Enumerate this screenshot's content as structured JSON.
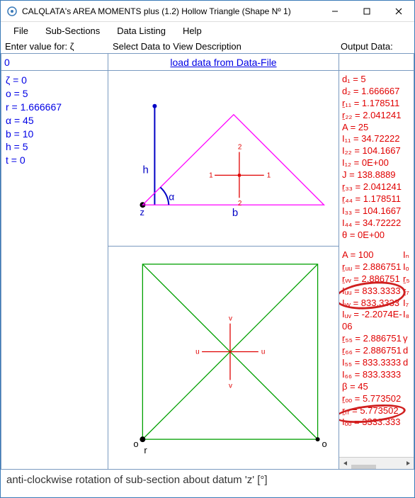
{
  "window": {
    "title": "CALQLATA's   AREA MOMENTS plus (1.2)   Hollow Triangle (Shape Nº 1)"
  },
  "menus": {
    "file": "File",
    "subs": "Sub-Sections",
    "data": "Data Listing",
    "help": "Help"
  },
  "labels": {
    "enter": "Enter value for: ζ",
    "select": "Select Data to View Description",
    "output": "Output Data:"
  },
  "input": {
    "value": "0"
  },
  "link": {
    "text": "load data from Data-File"
  },
  "left": {
    "l1": "ζ = 0",
    "l2": "o = 5",
    "l3": "r = 1.666667",
    "l4": "α = 45",
    "l5": "b = 10",
    "l6": "h = 5",
    "l7": "t = 0"
  },
  "out1": {
    "o1": "d₁ = 5",
    "o2": "d₂ = 1.666667",
    "o3": "ṟ₁₁ = 1.178511",
    "o4": "ṟ₂₂ = 2.041241",
    "o5": "A = 25",
    "o6": "I₁₁ = 34.72222",
    "o7": "I₂₂ = 104.1667",
    "o8": "I₁₂ = 0E+00",
    "o9": "J = 138.8889",
    "o10": "ṟ₃₃ = 2.041241",
    "o11": "ṟ₄₄ = 1.178511",
    "o12": "I₃₃ = 104.1667",
    "o13": "I₄₄ = 34.72222",
    "o14": "θ = 0E+00"
  },
  "out2": {
    "p1": "A = 100",
    "p2": "ṟᵤᵤ = 2.886751",
    "p3": "ṟᵥᵥ = 2.886751",
    "p4": "Iᵤᵤ = 833.3333",
    "p5": "Iᵥᵥ = 833.3333",
    "p6": "Iᵤᵥ = -2.2074E-06",
    "p7": "ṟ₅₅ = 2.886751",
    "p8": "ṟ₆₆ = 2.886751",
    "p9": "I₅₅ = 833.3333",
    "p10": "I₆₆ = 833.3333",
    "p11": "β = 45",
    "p12": "ṟₒₒ = 5.773502",
    "p13": "ṟᵣᵣ = 5.773502",
    "p14": "Iₒₒ = 3333.333",
    "q1": "Iₙ",
    "q2": "Iₒ",
    "q3": "ṟ₅",
    "q4": "ṟ₇",
    "q5": "I₇",
    "q6": "I₈",
    "q7": "γ",
    "q8": "d",
    "q9": "d"
  },
  "status": {
    "text": "anti-clockwise rotation of sub-section about datum 'z' [°]"
  },
  "diag": {
    "h": "h",
    "a": "α",
    "b": "b",
    "z": "z",
    "o": "o",
    "r": "r",
    "u": "u",
    "v": "v",
    "one": "1",
    "two": "2"
  },
  "chart_data": [
    {
      "type": "diagram",
      "shape": "triangle",
      "labels": {
        "h": "h (height)",
        "b": "b (base)",
        "alpha": "α (angle)",
        "z": "z (origin)"
      },
      "axes": [
        "1",
        "2"
      ]
    },
    {
      "type": "diagram",
      "shape": "square-with-diagonals",
      "labels": {
        "o": "o",
        "r": "r"
      },
      "axes": [
        "u",
        "v"
      ]
    }
  ]
}
